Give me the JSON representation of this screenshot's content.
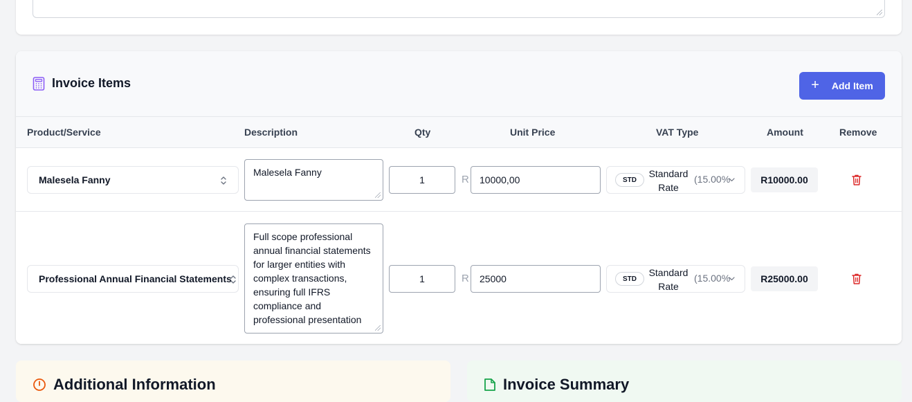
{
  "items_section": {
    "title": "Invoice Items",
    "add_button": "Add Item",
    "columns": [
      "Product/Service",
      "Description",
      "Qty",
      "Unit Price",
      "VAT Type",
      "Amount",
      "Remove"
    ],
    "currency_symbol": "R",
    "rows": [
      {
        "product": "Malesela Fanny",
        "description": "Malesela Fanny",
        "qty": "1",
        "unit_price": "10000,00",
        "vat_badge": "STD",
        "vat_name_line1": "Standard",
        "vat_name_line2": "Rate",
        "vat_rate": "(15.00%",
        "amount": "R10000.00"
      },
      {
        "product": "Professional Annual Financial Statements",
        "description": "Full scope professional annual financial statements for larger entities with complex transactions, ensuring full IFRS compliance and professional presentation",
        "qty": "1",
        "unit_price": "25000",
        "vat_badge": "STD",
        "vat_name_line1": "Standard",
        "vat_name_line2": "Rate",
        "vat_rate": "(15.00%",
        "amount": "R25000.00"
      }
    ]
  },
  "bottom": {
    "left_title": "Additional Information",
    "right_title": "Invoice Summary"
  },
  "colors": {
    "accent": "#4f64e6",
    "icon_purple": "#8b5cf6",
    "danger": "#dc2626",
    "warning": "#ea580c",
    "success": "#16a34a"
  }
}
